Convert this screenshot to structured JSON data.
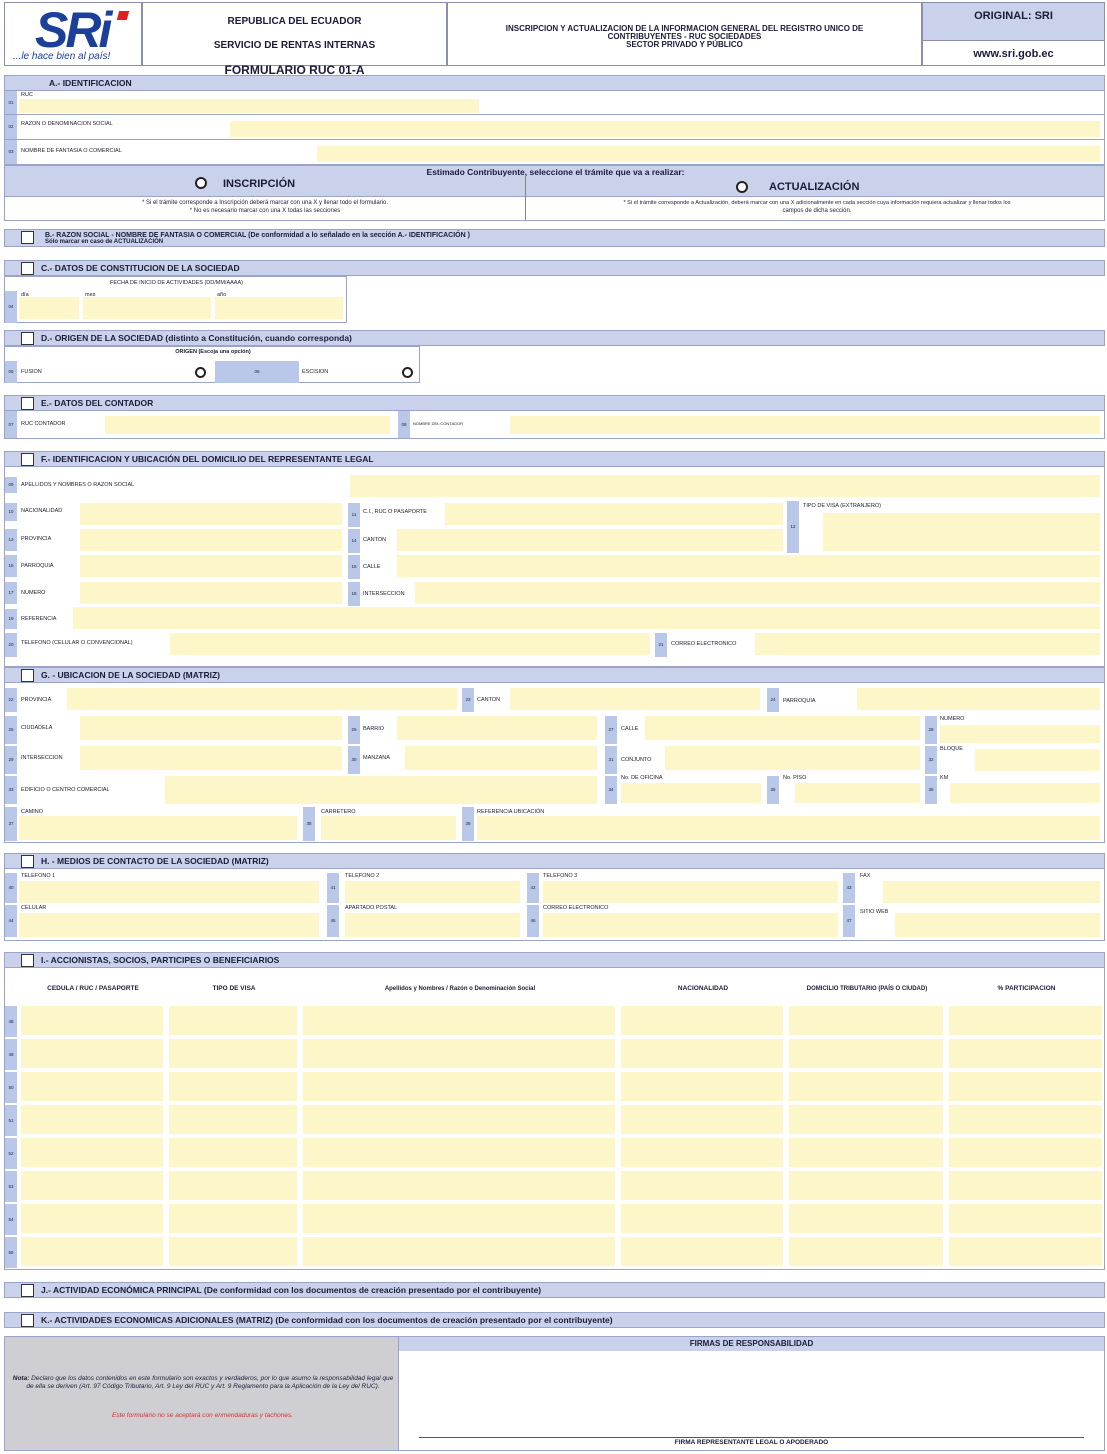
{
  "header": {
    "logo_text": "SRi",
    "slogan": "...le hace bien al país!",
    "org_line1": "REPUBLICA DEL ECUADOR",
    "org_line2": "SERVICIO DE RENTAS INTERNAS",
    "form_title": "FORMULARIO RUC 01-A",
    "desc_line1": "INSCRIPCION Y ACTUALIZACION DE LA INFORMACION GENERAL DEL REGISTRO UNICO DE",
    "desc_line2": "CONTRIBUYENTES - RUC SOCIEDADES",
    "desc_line3": "SECTOR PRIVADO Y PÚBLICO",
    "original": "ORIGINAL: SRI",
    "website": "www.sri.gob.ec"
  },
  "sections": {
    "a": "A.- IDENTIFICACION",
    "b": "B.- RAZON SOCIAL - NOMBRE DE FANTASIA O COMERCIAL (De conformidad a lo señalado en la sección A.- IDENTIFICACIÓN )",
    "b_sub": "Sólo marcar en caso de ACTUALIZACIÓN",
    "c": "C.- DATOS DE CONSTITUCION DE LA SOCIEDAD",
    "d": "D.- ORIGEN DE LA SOCIEDAD (distinto a Constitución, cuando corresponda)",
    "e": "E.- DATOS DEL CONTADOR",
    "f": "F.- IDENTIFICACION Y UBICACIÓN DEL DOMICILIO DEL REPRESENTANTE LEGAL",
    "g": "G. - UBICACION DE LA SOCIEDAD (MATRIZ)",
    "h": "H. - MEDIOS DE CONTACTO DE LA SOCIEDAD (MATRIZ)",
    "i": "I.- ACCIONISTAS, SOCIOS, PARTICIPES O BENEFICIARIOS",
    "j": "J.- ACTIVIDAD ECONÓMICA PRINCIPAL (De conformidad con los documentos de creación presentado por el contribuyente)",
    "k": "K.- ACTIVIDADES ECONOMICAS ADICIONALES (MATRIZ) (De conformidad con los documentos de creación presentado por el contribuyente)"
  },
  "fields_a": [
    {
      "num": "01",
      "label": "RUC"
    },
    {
      "num": "02",
      "label": "RAZON O DENOMINACION SOCIAL"
    },
    {
      "num": "03",
      "label": "NOMBRE DE FANTASIA O COMERCIAL"
    }
  ],
  "tramite": {
    "prompt": "Estimado Contribuyente, seleccione el trámite que va a realizar:",
    "inscripcion": "INSCRIPCIÓN",
    "actualizacion": "ACTUALIZACIÓN",
    "ins_note1": "* Si el trámite corresponde a Inscripción deberá marcar con una X y llenar todo el formulario.",
    "ins_note2": "* No es necesario marcar con una X todas las secciones",
    "act_note1": "* Si el trámite corresponde a Actualización, deberá marcar con una X adicionalmente en cada sección cuya información requiera actualizar y llenar todos los",
    "act_note2": "campos de dicha sección."
  },
  "c": {
    "title": "FECHA DE INICIO DE ACTIVIDADES (DD/MM/AAAA)",
    "num": "04",
    "dia": "día",
    "mes": "mes",
    "anio": "año"
  },
  "d": {
    "origen": "ORIGEN  (Escoja una opción)",
    "n05": "05",
    "fusion": "FUSION",
    "n06": "06",
    "escision": "ESCISION"
  },
  "e": {
    "n07": "07",
    "ruc": "RUC CONTADOR",
    "n08": "08",
    "nombre": "NOMBRE DEL CONTADOR"
  },
  "f": {
    "n09": "09",
    "apellidos": "APELLIDOS Y NOMBRES O RAZON SOCIAL",
    "n10": "10",
    "nacionalidad": "NACIONALIDAD",
    "n11": "11",
    "ci": "C.I., RUC O PASAPORTE",
    "n12": "12",
    "visa": "TIPO DE VISA (EXTRANJERO)",
    "n13": "13",
    "provincia": "PROVINCIA",
    "n14": "14",
    "canton": "CANTON",
    "n15": "15",
    "parroquia": "PARROQUIA",
    "n16": "16",
    "calle": "CALLE",
    "n17": "17",
    "numero": "NUMERO",
    "n18": "18",
    "interseccion": "INTERSECCION",
    "n19": "19",
    "referencia": "REFERENCIA",
    "n20": "20",
    "telefono": "TELEFONO (CELULAR O CONVENCIONAL)",
    "n21": "21",
    "correo": "CORREO ELECTRONICO"
  },
  "g": {
    "n22": "22",
    "provincia": "PROVINCIA",
    "n23": "23",
    "canton": "CANTON",
    "n24": "24",
    "parroquia": "PARROQUIA",
    "n25": "25",
    "ciudadela": "CIUDADELA",
    "n26": "26",
    "barrio": "BARRIO",
    "n27": "27",
    "calle": "CALLE",
    "n28": "28",
    "numero": "NUMERO",
    "n29": "29",
    "interseccion": "INTERSECCION",
    "n30": "30",
    "manzana": "MANZANA",
    "n31": "31",
    "conjunto": "CONJUNTO",
    "n32": "32",
    "bloque": "BLOQUE",
    "n33": "33",
    "edificio": "EDIFICIO O CENTRO COMERCIAL",
    "n34": "34",
    "oficina": "No. DE OFICINA",
    "n35": "35",
    "piso": "No. PISO",
    "n36": "36",
    "km": "KM",
    "n37": "37",
    "camino": "CAMINO",
    "n38": "38",
    "carretero": "CARRETERO",
    "n39": "39",
    "ref": "REFERENCIA UBICACIÓN"
  },
  "h": {
    "n40": "40",
    "tel1": "TELEFONO 1",
    "n41": "41",
    "tel2": "TELEFONO 2",
    "n42": "42",
    "tel3": "TELEFONO 3",
    "n43": "43",
    "fax": "FAX",
    "n44": "44",
    "celular": "CELULAR",
    "n45": "45",
    "apartado": "APARTADO POSTAL",
    "n46": "46",
    "correo": "CORREO ELECTRONICO",
    "n47": "47",
    "web": "SITIO WEB"
  },
  "i": {
    "columns": [
      "CEDULA / RUC / PASAPORTE",
      "TIPO DE VISA",
      "Apellidos y Nombres / Razón o Denominación Social",
      "NACIONALIDAD",
      "DOMICILIO TRIBUTARIO (PAÍS O CIUDAD)",
      "% PARTICIPACION"
    ],
    "rows": [
      "48",
      "49",
      "50",
      "51",
      "52",
      "53",
      "54",
      "55"
    ]
  },
  "footer": {
    "firmas": "FIRMAS DE RESPONSABILIDAD",
    "nota_label": "Nota:",
    "nota": "Declaro que los datos contenidos en este formulario son exactos y verdaderos, por lo que asumo la responsabilidad legal que de ella se deriven (Art. 97 Código Tributario, Art. 9 Ley del RUC y Art. 9 Reglamento para la Aplicación de la Ley del RUC).",
    "aviso": "Este formulario no se aceptará con enmendaduras y tachones.",
    "firma": "FIRMA REPRESENTANTE LEGAL O APODERADO"
  },
  "colors": {
    "header_blue": "#c9d2ea",
    "field_yellow": "#fdf6c9",
    "num_blue": "#b9c8e8",
    "logo_blue": "#1c3f9a",
    "accent_red": "#e02020"
  }
}
